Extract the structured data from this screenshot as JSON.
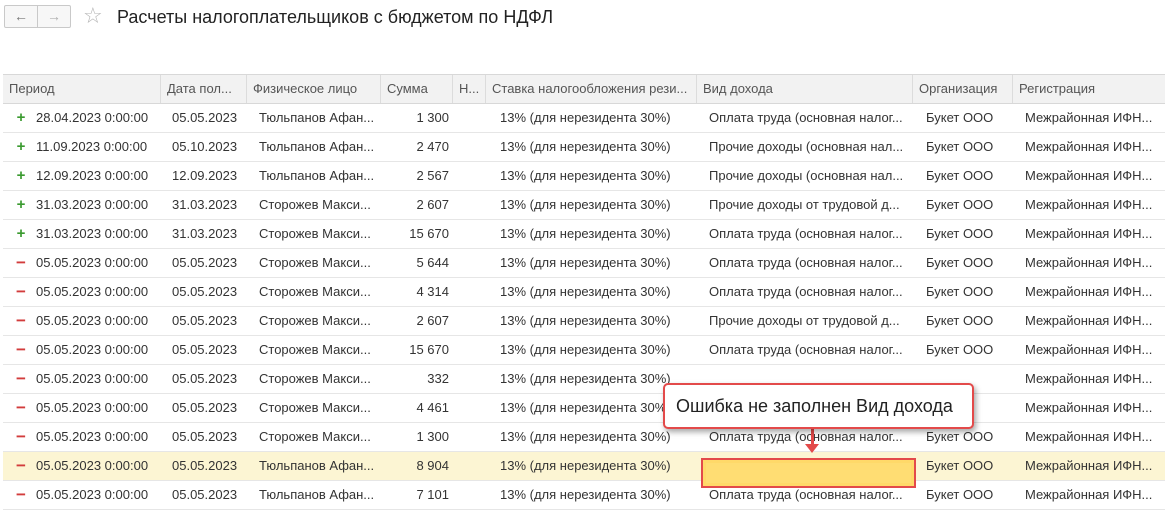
{
  "window": {
    "title": "Расчеты налогоплательщиков с бюджетом по НДФЛ",
    "back_icon": "←",
    "forward_icon": "→",
    "star_icon": "☆"
  },
  "table": {
    "columns": [
      "Период",
      "Дата пол...",
      "Физическое лицо",
      "Сумма",
      "Н...",
      "Ставка налогообложения рези...",
      "Вид дохода",
      "Организация",
      "Регистрация"
    ],
    "rows": [
      {
        "sign": "+",
        "period": "28.04.2023 0:00:00",
        "date": "05.05.2023",
        "person": "Тюльпанов Афан...",
        "sum": "1 300",
        "rate": "13% (для нерезидента 30%)",
        "income": "Оплата труда (основная налог...",
        "org": "Букет ООО",
        "reg": "Межрайонная ИФН..."
      },
      {
        "sign": "+",
        "period": "11.09.2023 0:00:00",
        "date": "05.10.2023",
        "person": "Тюльпанов Афан...",
        "sum": "2 470",
        "rate": "13% (для нерезидента 30%)",
        "income": "Прочие доходы (основная нал...",
        "org": "Букет ООО",
        "reg": "Межрайонная ИФН..."
      },
      {
        "sign": "+",
        "period": "12.09.2023 0:00:00",
        "date": "12.09.2023",
        "person": "Тюльпанов Афан...",
        "sum": "2 567",
        "rate": "13% (для нерезидента 30%)",
        "income": "Прочие доходы (основная нал...",
        "org": "Букет ООО",
        "reg": "Межрайонная ИФН..."
      },
      {
        "sign": "+",
        "period": "31.03.2023 0:00:00",
        "date": "31.03.2023",
        "person": "Сторожев Макси...",
        "sum": "2 607",
        "rate": "13% (для нерезидента 30%)",
        "income": "Прочие доходы от трудовой д...",
        "org": "Букет ООО",
        "reg": "Межрайонная ИФН..."
      },
      {
        "sign": "+",
        "period": "31.03.2023 0:00:00",
        "date": "31.03.2023",
        "person": "Сторожев Макси...",
        "sum": "15 670",
        "rate": "13% (для нерезидента 30%)",
        "income": "Оплата труда (основная налог...",
        "org": "Букет ООО",
        "reg": "Межрайонная ИФН..."
      },
      {
        "sign": "−",
        "period": "05.05.2023 0:00:00",
        "date": "05.05.2023",
        "person": "Сторожев Макси...",
        "sum": "5 644",
        "rate": "13% (для нерезидента 30%)",
        "income": "Оплата труда (основная налог...",
        "org": "Букет ООО",
        "reg": "Межрайонная ИФН..."
      },
      {
        "sign": "−",
        "period": "05.05.2023 0:00:00",
        "date": "05.05.2023",
        "person": "Сторожев Макси...",
        "sum": "4 314",
        "rate": "13% (для нерезидента 30%)",
        "income": "Оплата труда (основная налог...",
        "org": "Букет ООО",
        "reg": "Межрайонная ИФН..."
      },
      {
        "sign": "−",
        "period": "05.05.2023 0:00:00",
        "date": "05.05.2023",
        "person": "Сторожев Макси...",
        "sum": "2 607",
        "rate": "13% (для нерезидента 30%)",
        "income": "Прочие доходы от трудовой д...",
        "org": "Букет ООО",
        "reg": "Межрайонная ИФН..."
      },
      {
        "sign": "−",
        "period": "05.05.2023 0:00:00",
        "date": "05.05.2023",
        "person": "Сторожев Макси...",
        "sum": "15 670",
        "rate": "13% (для нерезидента 30%)",
        "income": "Оплата труда (основная налог...",
        "org": "Букет ООО",
        "reg": "Межрайонная ИФН..."
      },
      {
        "sign": "−",
        "period": "05.05.2023 0:00:00",
        "date": "05.05.2023",
        "person": "Сторожев Макси...",
        "sum": "332",
        "rate": "13% (для нерезидента 30%)",
        "income": "",
        "org": "",
        "reg": "Межрайонная ИФН..."
      },
      {
        "sign": "−",
        "period": "05.05.2023 0:00:00",
        "date": "05.05.2023",
        "person": "Сторожев Макси...",
        "sum": "4 461",
        "rate": "13% (для нерезидента 30%)",
        "income": "",
        "org": "",
        "reg": "Межрайонная ИФН..."
      },
      {
        "sign": "−",
        "period": "05.05.2023 0:00:00",
        "date": "05.05.2023",
        "person": "Сторожев Макси...",
        "sum": "1 300",
        "rate": "13% (для нерезидента 30%)",
        "income": "Оплата труда (основная налог...",
        "org": "Букет ООО",
        "reg": "Межрайонная ИФН..."
      },
      {
        "sign": "−",
        "period": "05.05.2023 0:00:00",
        "date": "05.05.2023",
        "person": "Тюльпанов Афан...",
        "sum": "8 904",
        "rate": "13% (для нерезидента 30%)",
        "income": "",
        "org": "Букет ООО",
        "reg": "Межрайонная ИФН...",
        "selected": true
      },
      {
        "sign": "−",
        "period": "05.05.2023 0:00:00",
        "date": "05.05.2023",
        "person": "Тюльпанов Афан...",
        "sum": "7 101",
        "rate": "13% (для нерезидента 30%)",
        "income": "Оплата труда (основная налог...",
        "org": "Букет ООО",
        "reg": "Межрайонная ИФН..."
      }
    ]
  },
  "callout": {
    "text": "Ошибка не заполнен Вид дохода"
  },
  "colors": {
    "plus": "#3a9a2f",
    "minus": "#d23c3c",
    "highlight": "#e34a4a",
    "selected_row": "#fcf5d3",
    "empty_field": "#ffd969"
  }
}
